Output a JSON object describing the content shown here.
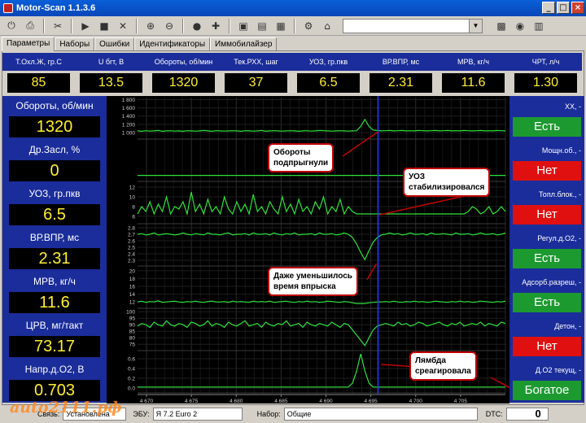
{
  "window": {
    "title": "Motor-Scan 1.1.3.6",
    "min": "_",
    "max": "□",
    "close": "×"
  },
  "tabs": [
    "Параметры",
    "Наборы",
    "Ошибки",
    "Идентификаторы",
    "Иммобилайзер"
  ],
  "params": [
    {
      "label": "Т.Охл.Ж, гр.С",
      "value": "85"
    },
    {
      "label": "U бrт, В",
      "value": "13.5"
    },
    {
      "label": "Обороты, об/мин",
      "value": "1320"
    },
    {
      "label": "Тек.РХХ, шаг",
      "value": "37"
    },
    {
      "label": "УОЗ, гр.пкв",
      "value": "6.5"
    },
    {
      "label": "ВР.ВПР, мс",
      "value": "2.31"
    },
    {
      "label": "МРВ, кг/ч",
      "value": "11.6"
    },
    {
      "label": "ЧРТ, л/ч",
      "value": "1.30"
    }
  ],
  "left": [
    {
      "label": "Обороты, об/мин",
      "value": "1320"
    },
    {
      "label": "Др.Засл, %",
      "value": "0"
    },
    {
      "label": "УОЗ, гр.пкв",
      "value": "6.5"
    },
    {
      "label": "ВР.ВПР, мс",
      "value": "2.31"
    },
    {
      "label": "МРВ, кг/ч",
      "value": "11.6"
    },
    {
      "label": "ЦРВ, мг/такт",
      "value": "73.17"
    },
    {
      "label": "Напр.д.О2, В",
      "value": "0.703"
    }
  ],
  "right": [
    {
      "label": "ХХ, -",
      "value": "Есть",
      "state": "yes"
    },
    {
      "label": "Мощн.об., -",
      "value": "Нет",
      "state": "no"
    },
    {
      "label": "Топл.блок., -",
      "value": "Нет",
      "state": "no"
    },
    {
      "label": "Регул.д.О2, -",
      "value": "Есть",
      "state": "yes"
    },
    {
      "label": "Адсорб.разреш, -",
      "value": "Есть",
      "state": "yes"
    },
    {
      "label": "Детон, -",
      "value": "Нет",
      "state": "no"
    },
    {
      "label": "Д.О2 текущ, -",
      "value": "Богатое",
      "state": "yes"
    }
  ],
  "callouts": {
    "c1": "Обороты\nподпрыгнули",
    "c2": "УОЗ\nстабилизировался",
    "c3": "Даже уменьшилось\nвремя впрыска",
    "c4": "Лямбда\nсреагировала"
  },
  "chart_data": {
    "type": "line",
    "x_ticks": [
      "4 670",
      "4 675",
      "4 680",
      "4 685",
      "4 690",
      "4 695",
      "4 700",
      "4 705"
    ],
    "xlim": [
      4669,
      4710
    ],
    "cursor_x": 4695.8,
    "grid": true,
    "series": [
      {
        "ticks": [
          "1 800",
          "1 600",
          "1 400",
          "1 200",
          "1 000"
        ],
        "ylim": [
          900,
          1850
        ],
        "values": [
          1040,
          1030,
          1045,
          1035,
          1040,
          1050,
          1030,
          1040,
          1045,
          1035,
          1040,
          1030,
          1045,
          1040,
          1035,
          1040,
          1050,
          1040,
          1030,
          1045,
          1040,
          1035,
          1040,
          1045,
          1040,
          1030,
          1045,
          1040,
          1035,
          1040,
          1050,
          1030,
          1040,
          1045,
          1040,
          1035,
          1040,
          1045,
          1040,
          1030,
          1040,
          1045,
          1035,
          1040,
          1050,
          1045,
          1040,
          1035,
          1040,
          1045,
          1040,
          1035,
          1040,
          1045,
          1150,
          1320,
          1150,
          1060,
          1050,
          1040,
          1045,
          1050,
          1040,
          1045,
          1050,
          1040,
          1045,
          1040,
          1050,
          1045,
          1040,
          1045,
          1050,
          1040,
          1045,
          1050,
          1040,
          1045,
          1040,
          1050,
          1045,
          1040,
          1045,
          1050,
          1040,
          1045,
          1040,
          1050,
          1045,
          1040
        ]
      },
      {
        "ticks": [],
        "ylim": [
          -1,
          10
        ],
        "values": [
          0,
          0,
          0,
          0,
          0,
          0,
          0,
          0,
          0,
          0,
          0,
          0,
          0,
          0,
          0,
          0,
          0,
          0,
          0,
          0,
          0,
          0,
          0,
          0,
          0,
          0,
          0,
          0,
          0,
          0,
          0,
          0,
          0,
          0,
          0,
          0,
          0,
          0,
          0,
          0,
          0,
          0,
          0,
          0,
          0,
          0,
          0,
          0,
          0,
          0,
          0,
          0,
          0,
          0,
          0,
          0,
          0,
          0,
          0,
          0,
          0,
          0,
          0,
          0,
          0,
          0,
          0,
          0,
          0,
          0,
          0,
          0,
          0,
          0,
          0,
          0,
          0,
          0,
          0,
          0,
          0,
          0,
          0,
          0,
          0,
          0,
          0,
          0,
          0,
          0
        ]
      },
      {
        "ticks": [
          "12",
          "10",
          "8",
          "6"
        ],
        "ylim": [
          5,
          13
        ],
        "values": [
          6.5,
          8,
          7,
          9,
          6.5,
          8.5,
          7,
          10,
          6.5,
          8,
          7.5,
          9,
          6.5,
          11,
          7,
          8.5,
          6.5,
          9.5,
          7,
          8,
          6.5,
          10,
          7.5,
          6.5,
          9,
          7,
          8.5,
          6.5,
          10.5,
          7,
          8,
          6.5,
          9,
          7.5,
          6.5,
          10,
          7,
          8.5,
          6.5,
          9.5,
          7,
          8,
          6.5,
          9,
          7.5,
          10,
          6.5,
          8,
          7,
          9.5,
          6.5,
          8,
          7,
          6.5,
          6.5,
          6.5,
          6.5,
          6.5,
          6.5,
          6.5,
          6.5,
          6.5,
          6.5,
          6.5,
          6.5,
          6.5,
          6.5,
          6.5,
          6.5,
          6.5,
          6.5,
          6.5,
          6.5,
          6.5,
          6.5,
          6.5,
          6.5,
          6.5,
          6.5,
          6.5,
          7,
          8,
          7.5,
          6.5,
          7,
          8,
          6.5,
          7,
          8,
          7
        ]
      },
      {
        "ticks": [
          "2.8",
          "2.7",
          "2.6",
          "2.5",
          "2.4",
          "2.3"
        ],
        "ylim": [
          2.25,
          2.85
        ],
        "values": [
          2.7,
          2.71,
          2.69,
          2.7,
          2.72,
          2.69,
          2.7,
          2.71,
          2.7,
          2.69,
          2.7,
          2.72,
          2.7,
          2.69,
          2.71,
          2.7,
          2.69,
          2.72,
          2.7,
          2.7,
          2.69,
          2.71,
          2.72,
          2.69,
          2.7,
          2.7,
          2.71,
          2.69,
          2.72,
          2.7,
          2.7,
          2.71,
          2.69,
          2.72,
          2.7,
          2.69,
          2.71,
          2.7,
          2.72,
          2.69,
          2.7,
          2.7,
          2.71,
          2.69,
          2.72,
          2.7,
          2.7,
          2.71,
          2.69,
          2.7,
          2.72,
          2.7,
          2.65,
          2.55,
          2.42,
          2.31,
          2.45,
          2.58,
          2.65,
          2.69,
          2.7,
          2.72,
          2.7,
          2.71,
          2.69,
          2.7,
          2.72,
          2.7,
          2.7,
          2.71,
          2.69,
          2.72,
          2.7,
          2.7,
          2.71,
          2.7,
          2.69,
          2.72,
          2.7,
          2.7,
          2.71,
          2.69,
          2.7,
          2.72,
          2.7,
          2.7,
          2.71,
          2.69,
          2.7,
          2.72
        ]
      },
      {
        "ticks": [
          "20",
          "18",
          "16",
          "14",
          "12"
        ],
        "ylim": [
          11,
          21
        ],
        "values": [
          12,
          12.2,
          11.9,
          12.1,
          12,
          12.3,
          11.9,
          12,
          12.1,
          12.2,
          12,
          11.9,
          12.1,
          12,
          12.2,
          12,
          11.9,
          12.1,
          12.2,
          12,
          12,
          12.1,
          11.9,
          12.2,
          12,
          12.1,
          12,
          11.9,
          12.2,
          12,
          12.1,
          12,
          12.2,
          11.9,
          12,
          12.1,
          12.2,
          12,
          11.9,
          12.1,
          12,
          12.2,
          12,
          12.1,
          11.9,
          12,
          12.2,
          12.1,
          12,
          11.9,
          12.1,
          12,
          11.8,
          11.6,
          11.6,
          11.6,
          11.8,
          11.9,
          12,
          12,
          12.1,
          12,
          12.2,
          12,
          11.9,
          12.1,
          12,
          12.2,
          12,
          12.1,
          11.9,
          12,
          12.2,
          12.1,
          12,
          11.9,
          12.1,
          12,
          12.2,
          12,
          12.1,
          11.9,
          12,
          12.2,
          12.1,
          12,
          11.9,
          12.1,
          12,
          12.2
        ]
      },
      {
        "ticks": [
          "100",
          "95",
          "90",
          "85",
          "80",
          "75"
        ],
        "ylim": [
          72,
          102
        ],
        "values": [
          89,
          91,
          90,
          88,
          92,
          90,
          89,
          93,
          90,
          89,
          91,
          90,
          88,
          92,
          91,
          89,
          90,
          93,
          89,
          91,
          90,
          88,
          92,
          90,
          89,
          91,
          93,
          89,
          90,
          91,
          88,
          92,
          90,
          89,
          91,
          90,
          93,
          89,
          90,
          91,
          88,
          92,
          90,
          89,
          91,
          90,
          89,
          92,
          90,
          88,
          91,
          90,
          86,
          82,
          78,
          74,
          80,
          86,
          89,
          90,
          91,
          90,
          89,
          92,
          90,
          91,
          89,
          90,
          92,
          91,
          89,
          90,
          91,
          92,
          90,
          89,
          91,
          90,
          92,
          89,
          90,
          91,
          90,
          92,
          89,
          91,
          90,
          89,
          92,
          91
        ]
      },
      {
        "ticks": [
          "0.6",
          "0.4",
          "0.2",
          "0.0"
        ],
        "ylim": [
          -0.05,
          0.75
        ],
        "values": [
          0.02,
          0.02,
          0.02,
          0.02,
          0.02,
          0.02,
          0.02,
          0.02,
          0.02,
          0.02,
          0.02,
          0.02,
          0.02,
          0.02,
          0.02,
          0.02,
          0.02,
          0.02,
          0.02,
          0.02,
          0.02,
          0.02,
          0.02,
          0.02,
          0.02,
          0.02,
          0.02,
          0.02,
          0.02,
          0.02,
          0.02,
          0.02,
          0.02,
          0.02,
          0.02,
          0.02,
          0.02,
          0.02,
          0.02,
          0.02,
          0.02,
          0.02,
          0.02,
          0.02,
          0.02,
          0.02,
          0.02,
          0.02,
          0.02,
          0.02,
          0.02,
          0.02,
          0.1,
          0.35,
          0.7,
          0.35,
          0.1,
          0.02,
          0.02,
          0.02,
          0.02,
          0.02,
          0.02,
          0.02,
          0.02,
          0.02,
          0.02,
          0.02,
          0.02,
          0.02,
          0.02,
          0.02,
          0.02,
          0.02,
          0.02,
          0.02,
          0.02,
          0.02,
          0.02,
          0.02,
          0.02,
          0.02,
          0.02,
          0.02,
          0.02,
          0.02,
          0.02,
          0.02,
          0.02,
          0.02
        ]
      }
    ]
  },
  "statusbar": {
    "link_label": "Связь:",
    "link_value": "Установлена",
    "ecu_label": "ЭБУ:",
    "ecu_value": "Я 7.2 Euro 2",
    "set_label": "Набор:",
    "set_value": "Общие",
    "dtc_label": "DTC:",
    "dtc_value": "0"
  },
  "watermark": "auto2111.рф"
}
